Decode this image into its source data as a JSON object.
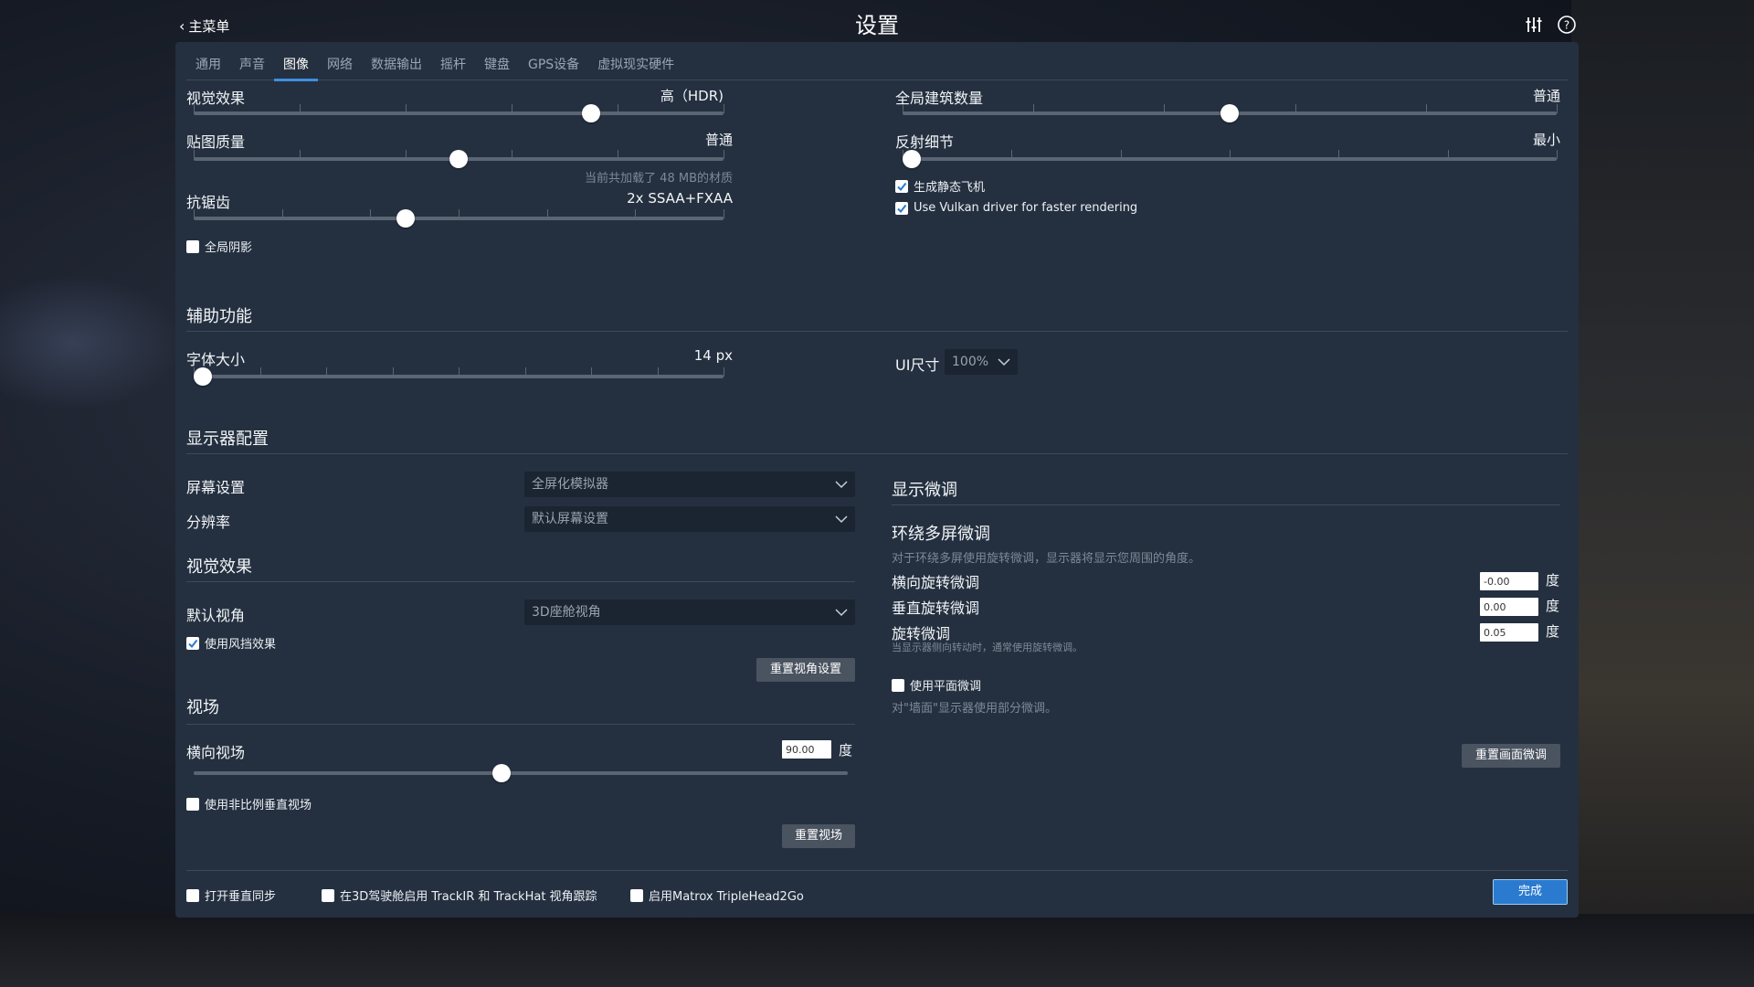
{
  "header": {
    "back_label": "主菜单",
    "title": "设置"
  },
  "tabs": [
    {
      "label": "通用"
    },
    {
      "label": "声音"
    },
    {
      "label": "图像"
    },
    {
      "label": "网络"
    },
    {
      "label": "数据输出"
    },
    {
      "label": "摇杆"
    },
    {
      "label": "键盘"
    },
    {
      "label": "GPS设备"
    },
    {
      "label": "虚拟现实硬件"
    }
  ],
  "active_tab": "图像",
  "graphics": {
    "visual_effects": {
      "label": "视觉效果",
      "value": "高（HDR)",
      "level": 0.75
    },
    "texture_quality": {
      "label": "贴图质量",
      "value": "普通",
      "level": 0.5,
      "hint": "当前共加载了 48 MB的材质"
    },
    "antialiasing": {
      "label": "抗锯齿",
      "value": "2x SSAA+FXAA",
      "level": 0.4
    },
    "global_shadows": {
      "label": "全局阴影",
      "checked": false
    },
    "building_count": {
      "label": "全局建筑数量",
      "value": "普通",
      "level": 0.5
    },
    "reflection_detail": {
      "label": "反射细节",
      "value": "最小",
      "level": 0.0
    },
    "static_aircraft": {
      "label": "生成静态飞机",
      "checked": true
    },
    "vulkan": {
      "label": "Use Vulkan driver for faster rendering",
      "checked": true
    }
  },
  "accessibility": {
    "title": "辅助功能",
    "font_size": {
      "label": "字体大小",
      "value": "14 px",
      "level": 0.0
    },
    "ui_size": {
      "label": "UI尺寸",
      "value": "100%"
    }
  },
  "monitor": {
    "title": "显示器配置",
    "screen": {
      "label": "屏幕设置",
      "value": "全屏化模拟器"
    },
    "resolution": {
      "label": "分辨率",
      "value": "默认屏幕设置"
    },
    "visual_title": "视觉效果",
    "default_view": {
      "label": "默认视角",
      "value": "3D座舱视角"
    },
    "windshield": {
      "label": "使用风挡效果",
      "checked": true
    },
    "reset_view_button": "重置视角设置",
    "fov_title": "视场",
    "hfov": {
      "label": "横向视场",
      "value": "90.00",
      "unit": "度",
      "level": 0.47
    },
    "nonprop_vfov": {
      "label": "使用非比例垂直视场",
      "checked": false
    },
    "reset_fov_button": "重置视场"
  },
  "fine_tune": {
    "title": "显示微调",
    "surround_title": "环绕多屏微调",
    "surround_desc": "对于环绕多屏使用旋转微调，显示器将显示您周围的角度。",
    "horizontal": {
      "label": "横向旋转微调",
      "value": "-0.00",
      "unit": "度"
    },
    "vertical": {
      "label": "垂直旋转微调",
      "value": "0.00",
      "unit": "度"
    },
    "roll": {
      "label": "旋转微调",
      "value": "0.05",
      "unit": "度",
      "hint": "当显示器侧向转动时，通常使用旋转微调。"
    },
    "flat": {
      "label": "使用平面微调",
      "checked": false
    },
    "flat_hint": "对\"墙面\"显示器使用部分微调。",
    "reset_button": "重置画面微调"
  },
  "footer": {
    "vsync": {
      "label": "打开垂直同步",
      "checked": false
    },
    "trackir": {
      "label": "在3D驾驶舱启用 TrackIR 和 TrackHat 视角跟踪",
      "checked": false
    },
    "matrox": {
      "label": "启用Matrox TripleHead2Go",
      "checked": false
    },
    "done_button": "完成"
  },
  "colors": {
    "panel": "#243040",
    "accent": "#3d8fe0",
    "primary_button": "#2a7bd0"
  }
}
